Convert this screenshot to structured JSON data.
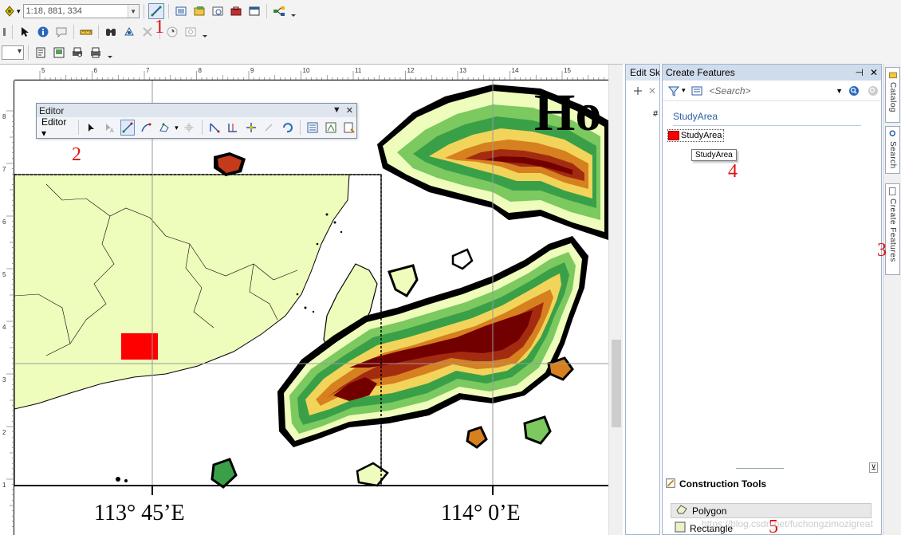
{
  "toolbar": {
    "scale_value": "1:18, 881, 334"
  },
  "annotations": {
    "n1": "1",
    "n2": "2",
    "n3": "3",
    "n4": "4",
    "n5": "5"
  },
  "editor_toolbar": {
    "title": "Editor",
    "menu_label": "Editor"
  },
  "map": {
    "title_fragment": "Ho",
    "lon_label_1": "113° 45’E",
    "lon_label_2": "114° 0’E",
    "top_ruler_ticks": [
      "5",
      "6",
      "7",
      "8",
      "9",
      "10",
      "11",
      "12",
      "13",
      "14",
      "15",
      "16"
    ],
    "left_ruler_ticks": [
      "8",
      "7",
      "6",
      "5",
      "4",
      "3",
      "2",
      "1"
    ],
    "colors": {
      "land": "#eefcbc",
      "study_area": "#ff0000"
    }
  },
  "edit_sketch": {
    "tab_label": "Edit Sk",
    "row_marker": "#"
  },
  "create_features": {
    "title": "Create Features",
    "search_placeholder": "<Search>",
    "group_name": "StudyArea",
    "template_name": "StudyArea",
    "tooltip": "StudyArea",
    "construction_tools_title": "Construction Tools",
    "tools": [
      "Polygon",
      "Rectangle"
    ]
  },
  "side_tabs": [
    "Catalog",
    "Search",
    "Create Features"
  ],
  "watermark": "https://blog.csdn.net/fuchongzimozigreat"
}
